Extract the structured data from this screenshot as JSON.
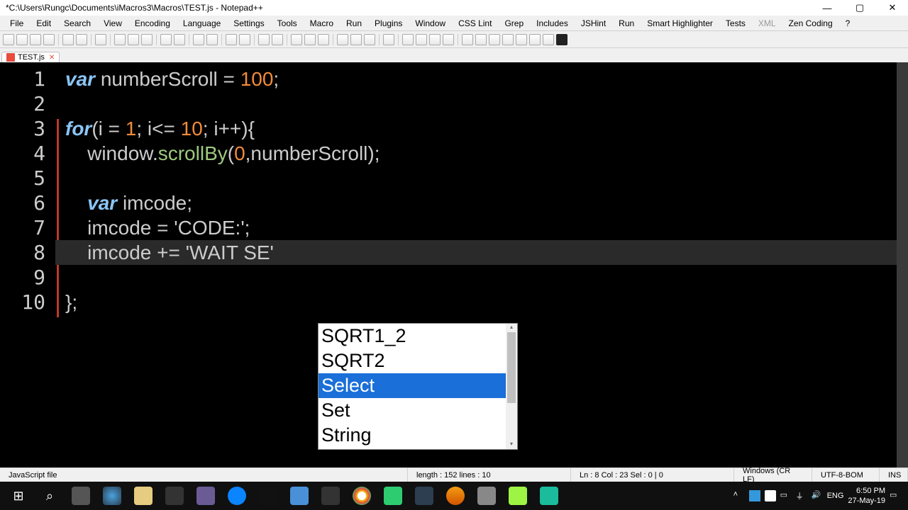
{
  "titlebar": {
    "title": "*C:\\Users\\Rungc\\Documents\\iMacros3\\Macros\\TEST.js - Notepad++"
  },
  "winbtns": {
    "min": "—",
    "max": "▢",
    "close": "✕"
  },
  "menus": [
    "File",
    "Edit",
    "Search",
    "View",
    "Encoding",
    "Language",
    "Settings",
    "Tools",
    "Macro",
    "Run",
    "Plugins",
    "Window",
    "CSS Lint",
    "Grep",
    "Includes",
    "JSHint",
    "Run",
    "Smart Highlighter",
    "Tests",
    "XML",
    "Zen Coding",
    "?"
  ],
  "menus_disabled": {
    "20": true
  },
  "tab": {
    "label": "TEST.js",
    "close": "✕"
  },
  "lines": [
    "1",
    "2",
    "3",
    "4",
    "5",
    "6",
    "7",
    "8",
    "9",
    "10"
  ],
  "code": {
    "l1_kw": "var",
    "l1_rest": " numberScroll = ",
    "l1_num": "100",
    "l1_end": ";",
    "l3_kw": "for",
    "l3_rest": "(i = ",
    "l3_n1": "1",
    "l3_mid": "; i<= ",
    "l3_n2": "10",
    "l3_end": "; i++){",
    "l4_a": "    window.",
    "l4_b": "scrollBy",
    "l4_c": "(",
    "l4_n0": "0",
    "l4_d": ",numberScroll);",
    "l6_kw": "var",
    "l6_rest": " imcode;",
    "l7": "    imcode = ",
    "l7_str": "'CODE:'",
    "l7_end": ";",
    "l8": "    imcode += ",
    "l8_str": "'WAIT SE'",
    "l10": "};"
  },
  "autocomplete": {
    "items": [
      "SQRT1_2",
      "SQRT2",
      "Select",
      "Set",
      "String"
    ],
    "selected": 2
  },
  "status": {
    "left": "JavaScript file",
    "length": "length : 152    lines : 10",
    "pos": "Ln : 8    Col : 23    Sel : 0 | 0",
    "eol": "Windows (CR LF)",
    "enc": "UTF-8-BOM",
    "mode": "INS"
  },
  "clock": {
    "time": "6:50 PM",
    "date": "27-May-19"
  }
}
